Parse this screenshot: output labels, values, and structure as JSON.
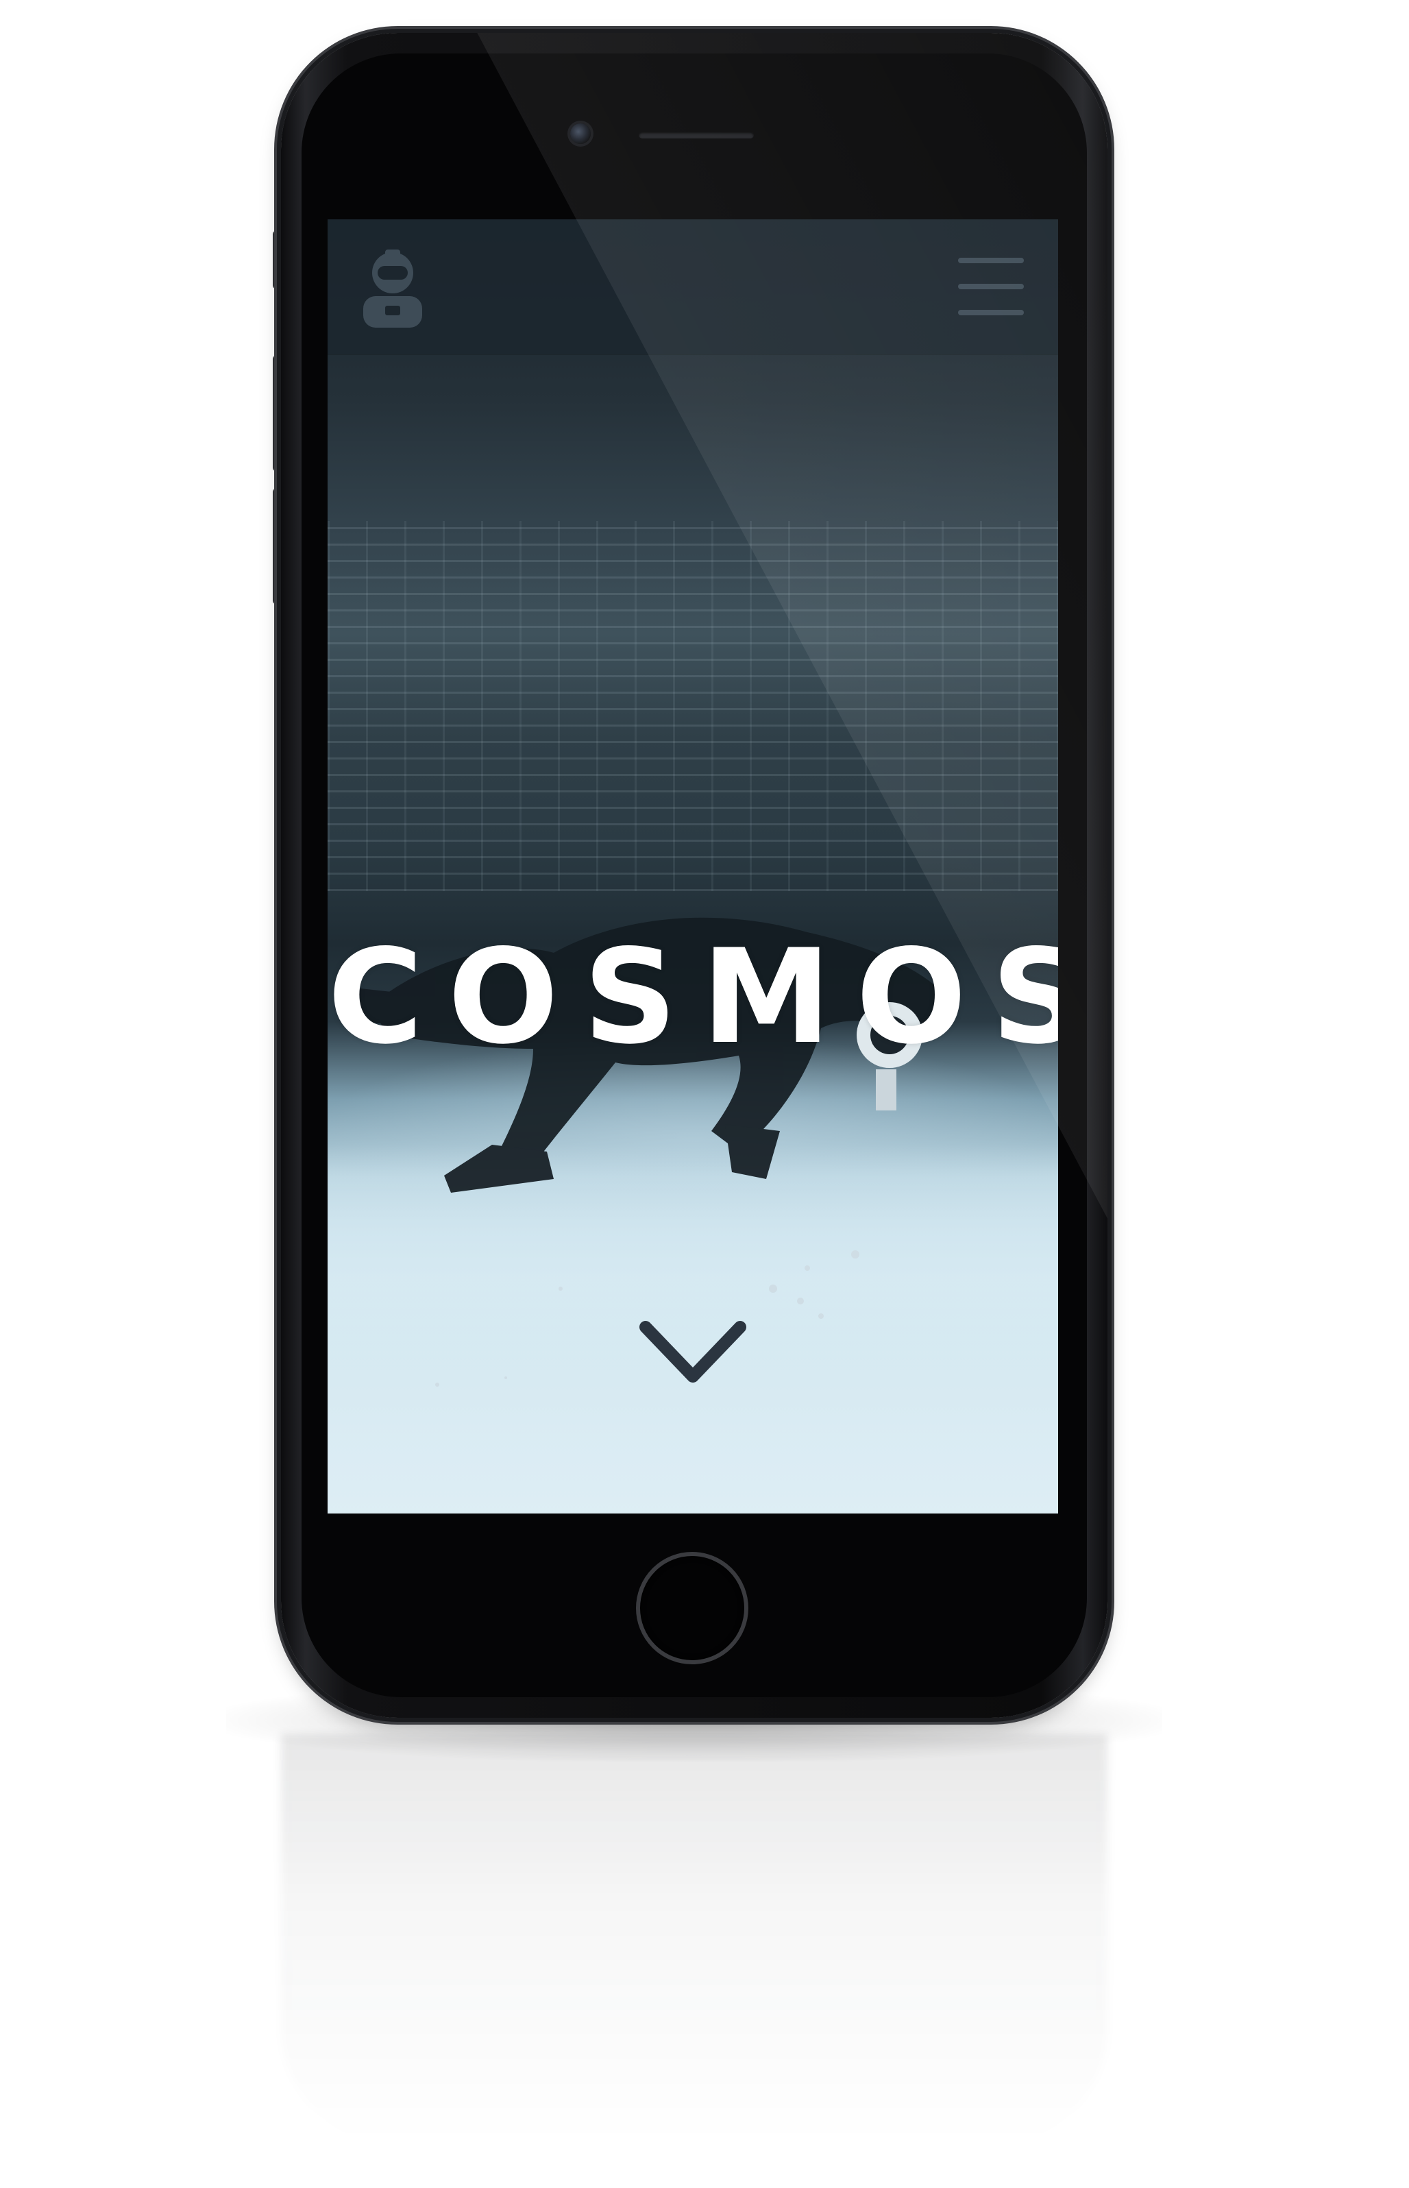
{
  "device": {
    "type": "smartphone",
    "color_scheme": "space-gray"
  },
  "app": {
    "header": {
      "logo_icon": "astronaut-icon",
      "menu_icon": "hamburger-menu-icon"
    },
    "hero": {
      "title": "COSMOS",
      "scroll_icon": "chevron-down-icon"
    }
  },
  "colors": {
    "header_bg": "#1c262e",
    "icon_gray": "#3e4c57",
    "title": "#ffffff",
    "chevron": "#2b3540",
    "phone_body": "#111113"
  }
}
